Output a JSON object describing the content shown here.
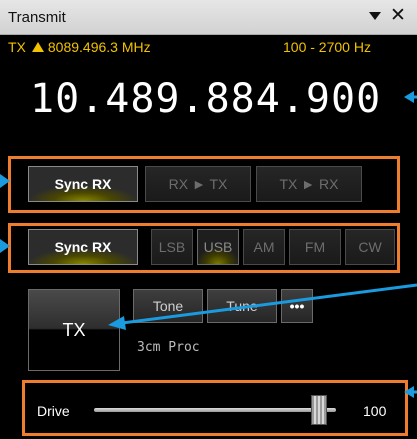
{
  "window": {
    "title": "Transmit"
  },
  "header": {
    "tx_prefix": "TX",
    "tx_frequency": "8089.496.3 MHz",
    "filter_range": "100 - 2700 Hz"
  },
  "frequency_display": "10.489.884.900",
  "row1": {
    "sync_rx_label": "Sync RX",
    "rx_to_tx_label": "RX ► TX",
    "tx_to_rx_label": "TX ► RX"
  },
  "row2": {
    "sync_rx_label": "Sync RX",
    "modes": [
      "LSB",
      "USB",
      "AM",
      "FM",
      "CW"
    ],
    "selected_mode": "USB"
  },
  "controls": {
    "tx_label": "TX",
    "tone_label": "Tone",
    "tune_label": "Tune",
    "more_label": "•••",
    "proc_text": "3cm Proc"
  },
  "drive": {
    "label": "Drive",
    "value": "100",
    "level": 0.96
  },
  "colors": {
    "accent_yellow": "#f2c200",
    "highlight_orange": "#ef7d2e",
    "annotation_blue": "#1a9be0"
  },
  "icons": {
    "collapse": "triangle-down-icon",
    "close": "close-icon"
  }
}
